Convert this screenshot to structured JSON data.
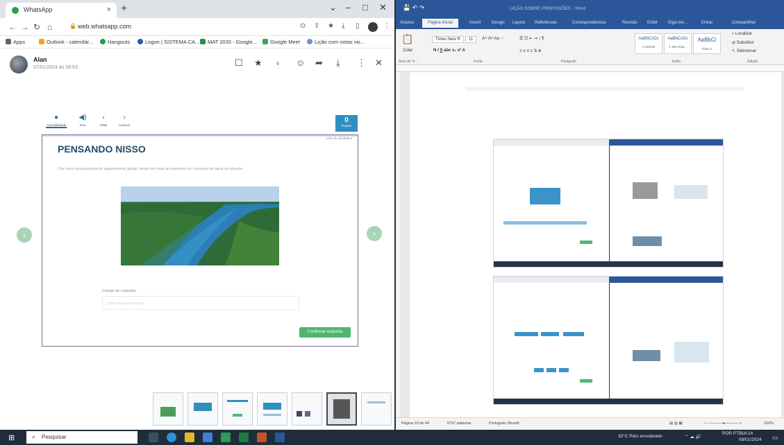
{
  "browser": {
    "tab_title": "WhatsApp",
    "url": "web.whatsapp.com",
    "bookmarks": [
      "Apps",
      "Outlook - calendár...",
      "Hangouts",
      "Logon | SISTEMA CA...",
      "MAT 2020 - Google...",
      "Google Meet",
      "Lição com notas vis..."
    ]
  },
  "chat": {
    "contact": "Alan",
    "timestamp": "07/01/2024 às 08:53"
  },
  "lesson": {
    "tools": [
      "Acessibilidade",
      "Som",
      "Voltar",
      "Avançar"
    ],
    "score_value": "0",
    "score_label": "Pontos",
    "card_small": "Lista de atividades",
    "title": "PENSANDO NISSO",
    "question": "Crie uma consequência do aquecimento global, tendo em vista um aumento no consumo de água no planeta.",
    "answer_label": "Campo de resposta",
    "answer_placeholder": "Digite aqui sua resposta",
    "submit": "Confirmar resposta"
  },
  "word": {
    "title": "LIÇÃO SOBRE PROFISSÕES - Word",
    "tabs": [
      "Arquivo",
      "Página Inicial",
      "Inserir",
      "Design",
      "Layout",
      "Referências",
      "Correspondências",
      "Revisão",
      "Exibir",
      "Diga-me...",
      "Entrar",
      "Compartilhar"
    ],
    "font_name": "Times New R",
    "font_size": "11",
    "paste": "Colar",
    "styles": [
      {
        "sample": "AaBbCcDc",
        "name": "1 Normal"
      },
      {
        "sample": "AaBbCcDc",
        "name": "1 Sem Esp..."
      },
      {
        "sample": "AaBbCi",
        "name": "Título 1"
      }
    ],
    "edit": [
      "Localizar",
      "Substituir",
      "Selecionar"
    ],
    "groups": [
      "Área de Tr...",
      "Fonte",
      "Parágrafo",
      "Estilo",
      "Edição"
    ],
    "status": {
      "page": "Página 16 de 44",
      "words": "5797 palavras",
      "language": "Português (Brasil)",
      "zoom": "100%"
    }
  },
  "taskbar": {
    "search": "Pesquisar",
    "weather": "32°C Parc ensolarado",
    "lang": "POR PTB",
    "time": "16:14",
    "date": "09/01/2024"
  }
}
